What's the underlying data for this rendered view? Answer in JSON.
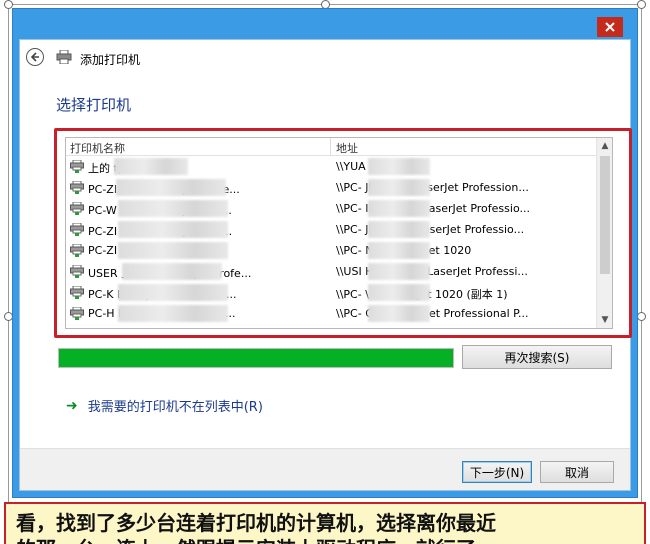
{
  "window": {
    "title": "添加打印机",
    "heading": "选择打印机"
  },
  "list": {
    "columns": {
      "name": "打印机名称",
      "address": "地址"
    },
    "rows": [
      {
        "name": "上的 tp",
        "address": "\\\\YUA          G\\tp"
      },
      {
        "name": "PC-ZI         的 HP LaserJet Profe...",
        "address": "\\\\PC-          JUAN\\HP LaserJet Profession..."
      },
      {
        "name": "PC-W             的 HP LaserJet Prof...",
        "address": "\\\\PC-          INHUA\\HP LaserJet Professio..."
      },
      {
        "name": "PC-ZI             的 HP LaserJet Prof...",
        "address": "\\\\PC-          JINJIN\\HP LaserJet Professio..."
      },
      {
        "name": "PC-ZI             HP LaserJet 1020",
        "address": "\\\\PC-          N\\HP LaserJet 1020"
      },
      {
        "name": "USER           上的 HP LaserJet Profe...",
        "address": "\\\\USI          HTCAJ1\\HP LaserJet Professi..."
      },
      {
        "name": "PC-K              LaserJet 1020 (副本 ...",
        "address": "\\\\PC-          \\HP LaserJet 1020 (副本 1)"
      },
      {
        "name": "PC-H              P LaserJet Professio...",
        "address": "\\\\PC-          G\\HP LaserJet Professional P..."
      }
    ]
  },
  "progress": {
    "value": 1.0,
    "color": "#06b025"
  },
  "buttons": {
    "search_again": "再次搜索(S)",
    "next": "下一步(N)",
    "cancel": "取消"
  },
  "link": {
    "not_listed": "我需要的打印机不在列表中(R)"
  },
  "caption": {
    "line1": "看，找到了多少台连着打印机的计算机，选择离你最近",
    "line2": "的那一台，连上，然跟提示安装上驱动程序，就行了"
  },
  "colors": {
    "accent": "#3b9be4",
    "highlight_border": "#c8202a",
    "close": "#c42b1c",
    "link": "#1b3a8c",
    "caption_bg": "#fdf6c7"
  }
}
